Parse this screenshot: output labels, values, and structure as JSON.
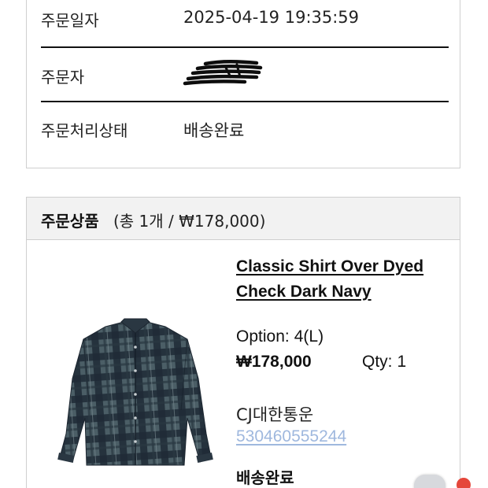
{
  "order_info": {
    "date_label": "주문일자",
    "date_value": "2025-04-19 19:35:59",
    "orderer_label": "주문자",
    "status_label": "주문처리상태",
    "status_value": "배송완료"
  },
  "items": {
    "title": "주문상품",
    "summary": "(총 1개 / ₩178,000)",
    "product": {
      "name": "Classic Shirt Over Dyed Check Dark Navy",
      "option_label": "Option:",
      "option_value": "4(L)",
      "price": "₩178,000",
      "qty_label": "Qty:",
      "qty_value": "1",
      "carrier": "CJ대한통운",
      "tracking_number": "530460555244",
      "shipping_status": "배송완료",
      "image_icon": "plaid-shirt-image"
    }
  },
  "colors": {
    "tracking_link": "#9fb8de",
    "header_bg": "#f2f2f2",
    "divider": "#111111",
    "notification_dot": "#e5463a"
  }
}
